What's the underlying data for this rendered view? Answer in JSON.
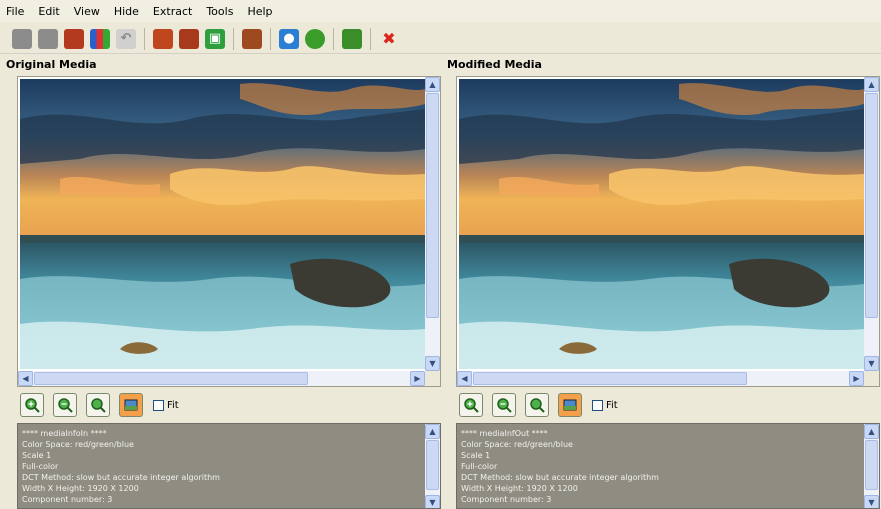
{
  "menu": [
    "File",
    "Edit",
    "View",
    "Hide",
    "Extract",
    "Tools",
    "Help"
  ],
  "toolbar": {
    "buttons": [
      {
        "name": "open-gray-icon",
        "color": "#8c8c8c"
      },
      {
        "name": "save-gray-icon",
        "color": "#8c8c8c"
      },
      {
        "name": "book-red-icon",
        "color": "#b33a1e"
      },
      {
        "name": "chart-icon",
        "color": "#2b60c8"
      },
      {
        "name": "undo-icon",
        "color": "#a9a9a9"
      },
      {
        "name": "book-orange-icon",
        "color": "#c0461d"
      },
      {
        "name": "book-orange-2-icon",
        "color": "#a83a1c"
      },
      {
        "name": "floppy-green-icon",
        "color": "#2f9e3c"
      },
      {
        "name": "book-brown-icon",
        "color": "#9e4a20"
      },
      {
        "name": "users-icon",
        "color": "#2a7fd3"
      },
      {
        "name": "leaf-icon",
        "color": "#3a9d2a"
      },
      {
        "name": "book-green-icon",
        "color": "#3a8e2a"
      },
      {
        "name": "close-red-icon",
        "color": "#d9271c"
      }
    ]
  },
  "panels": {
    "left": {
      "title": "Original Media",
      "fit_label": "Fit",
      "info": [
        "**** mediaInfoIn ****",
        "Color Space: red/green/blue",
        "Scale 1",
        "Full-color",
        "DCT Method: slow but accurate integer algorithm",
        "Width X Height: 1920 X 1200",
        "Component number: 3"
      ]
    },
    "right": {
      "title": "Modified Media",
      "fit_label": "Fit",
      "info": [
        "**** mediaInfOut ****",
        "Color Space: red/green/blue",
        "Scale 1",
        "Full-color",
        "DCT Method: slow but accurate integer algorithm",
        "Width X Height: 1920 X 1200",
        "Component number: 3"
      ]
    }
  },
  "zoom_buttons": [
    "zoom-in-icon",
    "zoom-out-icon",
    "zoom-fit-icon",
    "zoom-actual-icon"
  ],
  "colors": {
    "sky_top": "#2c4f73",
    "sunset": "#e99b3c",
    "sea": "#3c8fa0",
    "foam": "#cfe9ec"
  }
}
